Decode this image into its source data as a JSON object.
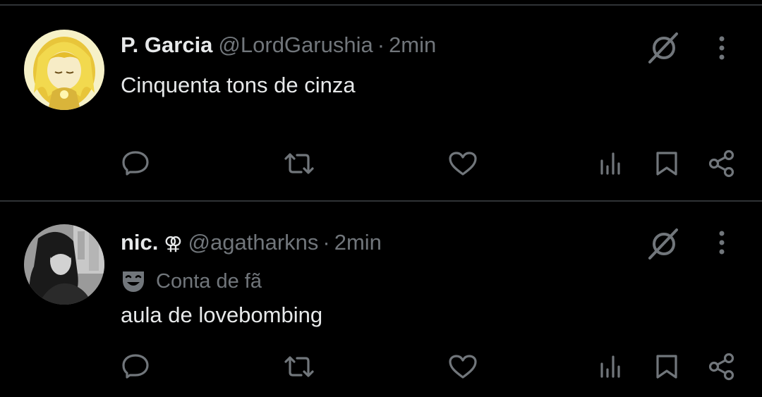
{
  "tweets": [
    {
      "name": "P. Garcia",
      "handle": "@LordGarushia",
      "separator": "·",
      "time": "2min",
      "text": "Cinquenta tons de cinza",
      "avatar_icon": "anime-character-avatar",
      "grok_icon": "grok-icon",
      "more_icon": "more-options-icon"
    },
    {
      "name": "nic.",
      "badge": "⚢",
      "handle": "@agatharkns",
      "separator": "·",
      "time": "2min",
      "label": "Conta de fã",
      "label_icon": "theater-masks-icon",
      "text": "aula de lovebombing",
      "avatar_icon": "bw-photo-avatar",
      "grok_icon": "grok-icon",
      "more_icon": "more-options-icon"
    }
  ],
  "actions": [
    "reply-icon",
    "retweet-icon",
    "like-icon",
    "views-icon",
    "bookmark-icon",
    "share-icon"
  ],
  "colors": {
    "background": "#000000",
    "text": "#e7e9ea",
    "secondary": "#71767b",
    "divider": "#2f3336"
  }
}
